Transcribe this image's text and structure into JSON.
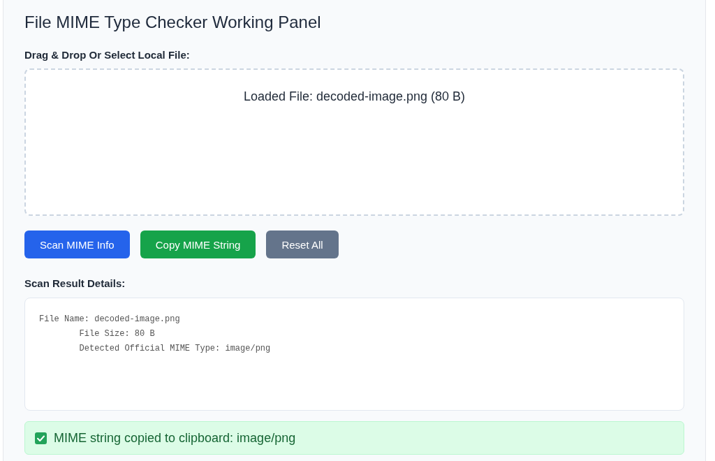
{
  "title": "File MIME Type Checker Working Panel",
  "upload": {
    "label": "Drag & Drop Or Select Local File:",
    "loaded_text": "Loaded File: decoded-image.png (80 B)"
  },
  "buttons": [
    {
      "label": "Scan MIME Info",
      "kind": "primary"
    },
    {
      "label": "Copy MIME String",
      "kind": "success"
    },
    {
      "label": "Reset All",
      "kind": "secondary"
    }
  ],
  "result": {
    "label": "Scan Result Details:",
    "text": "File Name: decoded-image.png\n        File Size: 80 B\n        Detected Official MIME Type: image/png"
  },
  "status": {
    "kind": "success",
    "text": "MIME string copied to clipboard: image/png"
  }
}
